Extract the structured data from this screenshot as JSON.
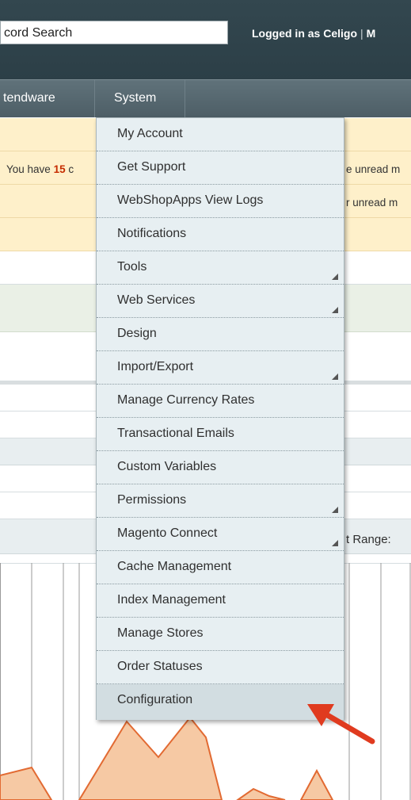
{
  "header": {
    "search_value": "cord Search",
    "login_text": "Logged in as Celigo",
    "separator": "|",
    "next_link_fragment": "M"
  },
  "nav": {
    "items": [
      {
        "label": "tendware"
      },
      {
        "label": "System"
      }
    ]
  },
  "notices": {
    "left_prefix": "You have ",
    "left_count": "15",
    "left_suffix": " c",
    "right_1": "e unread m",
    "right_2": "r unread m"
  },
  "content": {
    "range_label": "t Range:"
  },
  "system_menu": {
    "items": [
      {
        "label": "My Account",
        "has_submenu": false
      },
      {
        "label": "Get Support",
        "has_submenu": false
      },
      {
        "label": "WebShopApps View Logs",
        "has_submenu": false
      },
      {
        "label": "Notifications",
        "has_submenu": false
      },
      {
        "label": "Tools",
        "has_submenu": true
      },
      {
        "label": "Web Services",
        "has_submenu": true
      },
      {
        "label": "Design",
        "has_submenu": false
      },
      {
        "label": "Import/Export",
        "has_submenu": true
      },
      {
        "label": "Manage Currency Rates",
        "has_submenu": false
      },
      {
        "label": "Transactional Emails",
        "has_submenu": false
      },
      {
        "label": "Custom Variables",
        "has_submenu": false
      },
      {
        "label": "Permissions",
        "has_submenu": true
      },
      {
        "label": "Magento Connect",
        "has_submenu": true
      },
      {
        "label": "Cache Management",
        "has_submenu": false
      },
      {
        "label": "Index Management",
        "has_submenu": false
      },
      {
        "label": "Manage Stores",
        "has_submenu": false
      },
      {
        "label": "Order Statuses",
        "has_submenu": false
      },
      {
        "label": "Configuration",
        "has_submenu": false
      }
    ],
    "highlighted": "Configuration"
  },
  "colors": {
    "header_bg": "#2c3f47",
    "nav_bg": "#55666e",
    "menu_bg": "#e7eff2",
    "notice_bg": "#fef0ca",
    "count_red": "#c62c00",
    "arrow_red": "#e03b1f",
    "chart_fill": "#f6c9a4",
    "chart_line": "#e26a32"
  },
  "icons": {
    "submenu": "submenu-corner-icon",
    "annotation": "red-arrow-icon"
  }
}
